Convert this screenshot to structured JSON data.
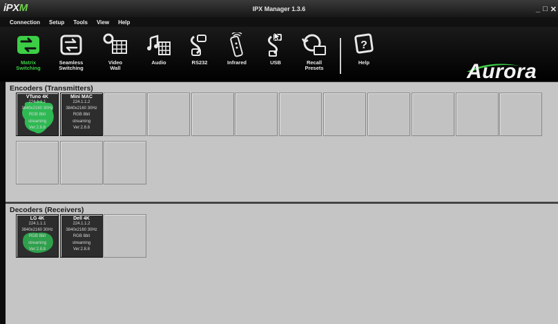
{
  "titlebar": {
    "logo_prefix": "iPX",
    "logo_suffix": "M",
    "title": "IPX Manager 1.3.6",
    "minimize": "_",
    "maximize": "□",
    "close": "✕"
  },
  "menu": [
    "Connection",
    "Setup",
    "Tools",
    "View",
    "Help"
  ],
  "toolbar": [
    {
      "label": "Matrix\nSwitching",
      "icon": "matrix-switching-icon",
      "active": true
    },
    {
      "label": "Seamless\nSwitching",
      "icon": "seamless-switching-icon"
    },
    {
      "label": "Video\nWall",
      "icon": "video-wall-icon"
    },
    {
      "label": "Audio",
      "icon": "audio-icon"
    },
    {
      "label": "RS232",
      "icon": "rs232-icon"
    },
    {
      "label": "Infrared",
      "icon": "infrared-remote-icon"
    },
    {
      "label": "USB",
      "icon": "usb-icon"
    },
    {
      "label": "Recall\nPresets",
      "icon": "recall-presets-icon"
    },
    {
      "label": "Help",
      "icon": "help-icon"
    }
  ],
  "brand": "Aurora",
  "colors": {
    "active": "#3ccf46",
    "streaming_glow": "#2fd25a",
    "panel_bg": "#c5c5c5",
    "device_bg": "#2d2d2d"
  },
  "encoders": {
    "title": "Encoders (Transmitters)",
    "devices": [
      {
        "name": "VTuno 4K",
        "ip": "224.1.1.1",
        "res": "3840x2160 30Hz",
        "color": "RGB 8bit",
        "status": "streaming",
        "ver": "Ver:2.8.8",
        "selected": true
      },
      {
        "name": "Mini MAC",
        "ip": "224.1.1.2",
        "res": "3840x2160 30Hz",
        "color": "RGB 8bit",
        "status": "streaming",
        "ver": "Ver:2.8.8"
      }
    ]
  },
  "decoders": {
    "title": "Decoders (Receivers)",
    "devices": [
      {
        "name": "LG 4K",
        "ip": "224.1.1.1",
        "res": "3840x2160 30Hz",
        "color": "RGB 8bit",
        "status": "streaming",
        "ver": "Ver:2.8.8",
        "selected": true
      },
      {
        "name": "Dell 4K",
        "ip": "224.1.1.2",
        "res": "3840x2160 30Hz",
        "color": "RGB 8bit",
        "status": "streaming",
        "ver": "Ver:2.8.8"
      }
    ]
  }
}
